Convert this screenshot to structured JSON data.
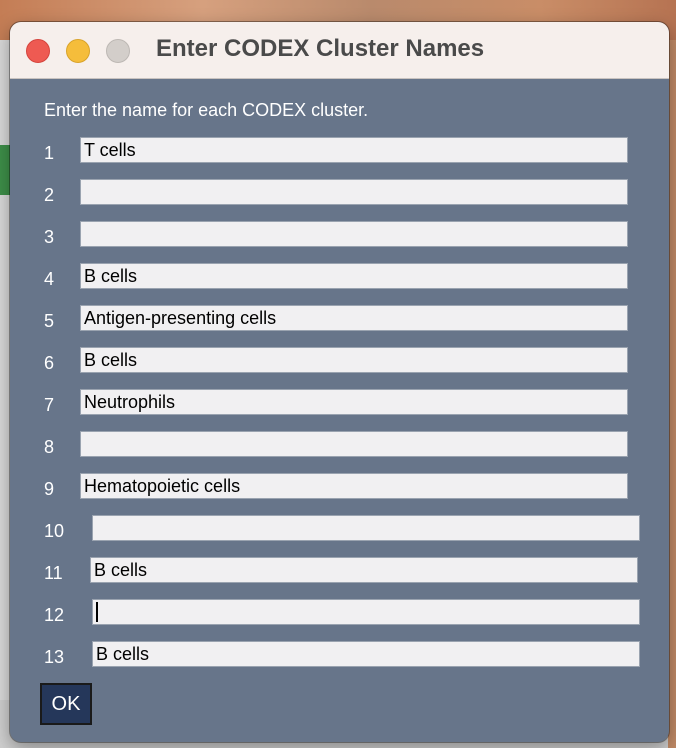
{
  "window": {
    "title": "Enter CODEX Cluster Names"
  },
  "instructions": "Enter the name for each CODEX cluster.",
  "rows": [
    {
      "number": "1",
      "value": "T cells"
    },
    {
      "number": "2",
      "value": ""
    },
    {
      "number": "3",
      "value": ""
    },
    {
      "number": "4",
      "value": "B cells"
    },
    {
      "number": "5",
      "value": "Antigen-presenting cells"
    },
    {
      "number": "6",
      "value": "B cells"
    },
    {
      "number": "7",
      "value": "Neutrophils"
    },
    {
      "number": "8",
      "value": ""
    },
    {
      "number": "9",
      "value": "Hematopoietic cells"
    },
    {
      "number": "10",
      "value": ""
    },
    {
      "number": "11",
      "value": "B cells"
    },
    {
      "number": "12",
      "value": ""
    },
    {
      "number": "13",
      "value": "B cells"
    }
  ],
  "ok_label": "OK",
  "colors": {
    "dialog_bg": "#67758a",
    "titlebar_bg": "#f6efec",
    "ok_button_bg": "#25375a",
    "close": "#ee5a52",
    "minimize": "#f5bd3b",
    "maximize": "#d3ceca"
  }
}
